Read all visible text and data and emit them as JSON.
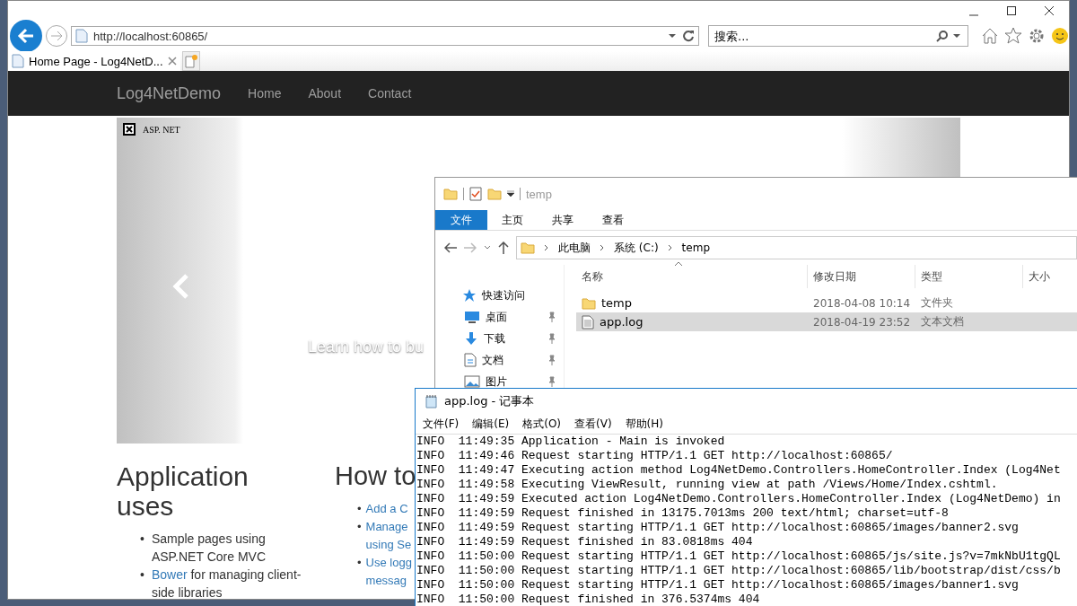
{
  "browser": {
    "address": "http://localhost:60865/",
    "search_placeholder": "搜索...",
    "tab": {
      "title": "Home Page - Log4NetD...",
      "selected": true
    },
    "page": {
      "brand": "Log4NetDemo",
      "nav": [
        "Home",
        "About",
        "Contact"
      ],
      "carousel": {
        "image_alt": "ASP. NET",
        "caption": "Learn how to bu"
      },
      "columns": [
        {
          "title": "Application uses",
          "items": [
            {
              "bullet": "•",
              "parts": [
                {
                  "text": "Sample pages using ASP.NET Core MVC",
                  "link": false
                }
              ]
            },
            {
              "bullet": "•",
              "parts": [
                {
                  "text": "Bower",
                  "link": true
                },
                {
                  "text": " for managing client-side libraries",
                  "link": false
                }
              ]
            }
          ]
        },
        {
          "title": "How to",
          "items": [
            {
              "bullet": "•",
              "lines": [
                "Add a C"
              ]
            },
            {
              "bullet": "•",
              "lines": [
                "Manage",
                "using Se"
              ]
            },
            {
              "bullet": "•",
              "lines": [
                "Use logg",
                "messag"
              ]
            }
          ]
        }
      ]
    }
  },
  "explorer": {
    "title": "temp",
    "ribbon_tabs": [
      {
        "label": "文件",
        "selected": true
      },
      {
        "label": "主页",
        "selected": false
      },
      {
        "label": "共享",
        "selected": false
      },
      {
        "label": "查看",
        "selected": false
      }
    ],
    "breadcrumb": [
      "此电脑",
      "系统 (C:)",
      "temp"
    ],
    "nav": [
      {
        "label": "快速访问",
        "kind": "quick-access",
        "pinned": false
      },
      {
        "label": "桌面",
        "kind": "desktop",
        "pinned": true
      },
      {
        "label": "下载",
        "kind": "downloads",
        "pinned": true
      },
      {
        "label": "文档",
        "kind": "documents",
        "pinned": true
      },
      {
        "label": "图片",
        "kind": "pictures",
        "pinned": true
      }
    ],
    "columns": [
      "名称",
      "修改日期",
      "类型",
      "大小"
    ],
    "files": [
      {
        "name": "temp",
        "kind": "folder",
        "modified": "2018-04-08 10:14",
        "type": "文件夹",
        "selected": false
      },
      {
        "name": "app.log",
        "kind": "text",
        "modified": "2018-04-19 23:52",
        "type": "文本文档",
        "selected": true
      }
    ]
  },
  "notepad": {
    "title": "app.log - 记事本",
    "menu": [
      "文件(F)",
      "编辑(E)",
      "格式(O)",
      "查看(V)",
      "帮助(H)"
    ],
    "lines": [
      "INFO  11:49:35 Application - Main is invoked",
      "INFO  11:49:46 Request starting HTTP/1.1 GET http://localhost:60865/",
      "INFO  11:49:47 Executing action method Log4NetDemo.Controllers.HomeController.Index (Log4Net",
      "INFO  11:49:58 Executing ViewResult, running view at path /Views/Home/Index.cshtml.",
      "INFO  11:49:59 Executed action Log4NetDemo.Controllers.HomeController.Index (Log4NetDemo) in",
      "INFO  11:49:59 Request finished in 13175.7013ms 200 text/html; charset=utf-8",
      "INFO  11:49:59 Request starting HTTP/1.1 GET http://localhost:60865/images/banner2.svg",
      "INFO  11:49:59 Request finished in 83.0818ms 404",
      "INFO  11:50:00 Request starting HTTP/1.1 GET http://localhost:60865/js/site.js?v=7mkNbU1tgQL",
      "INFO  11:50:00 Request starting HTTP/1.1 GET http://localhost:60865/lib/bootstrap/dist/css/b",
      "INFO  11:50:00 Request starting HTTP/1.1 GET http://localhost:60865/images/banner1.svg",
      "INFO  11:50:00 Request finished in 376.5374ms 404"
    ]
  }
}
